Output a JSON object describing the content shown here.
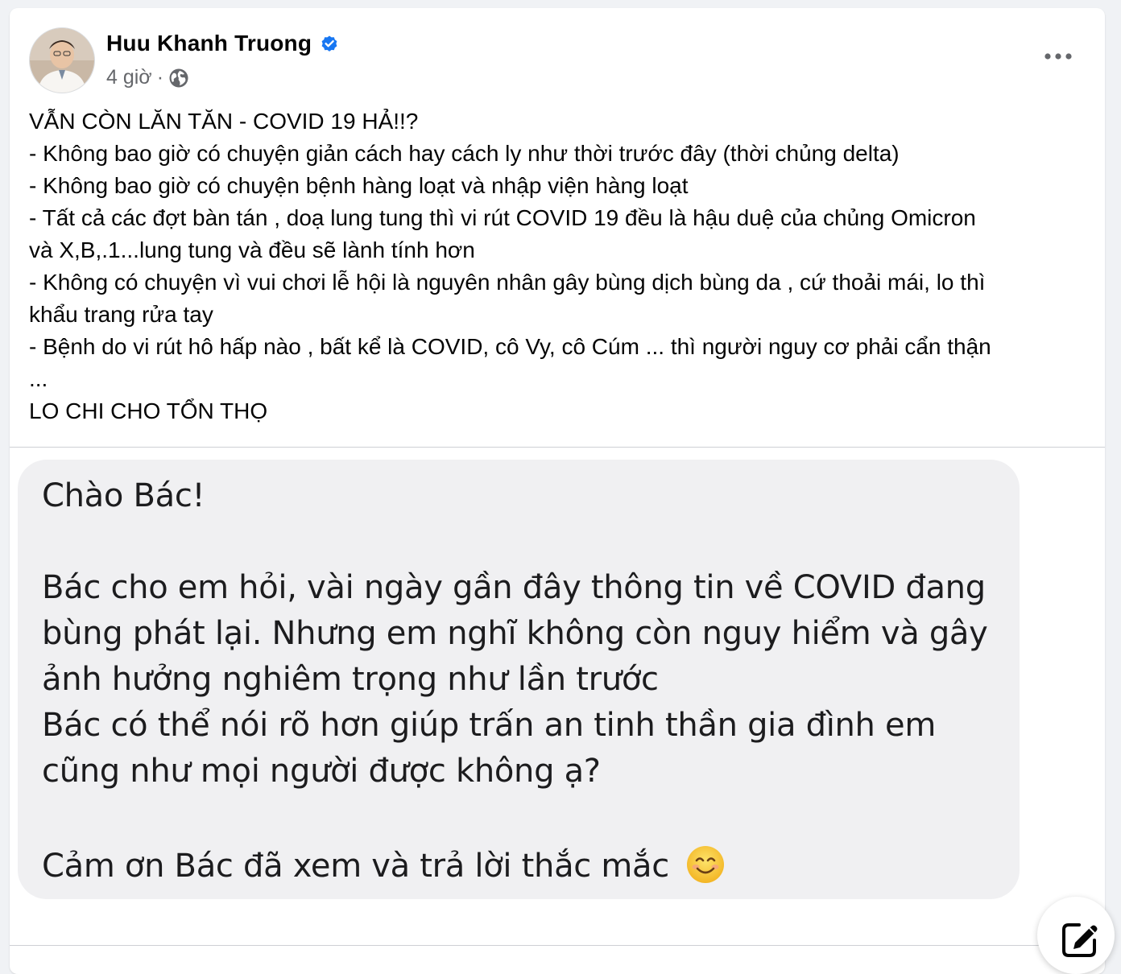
{
  "post": {
    "author": "Huu Khanh Truong",
    "time": "4 giờ",
    "separator": "·",
    "verified": true,
    "privacy_icon": "globe-icon",
    "more_icon": "more-dots-icon",
    "text_lines": [
      "VẪN CÒN LĂN TĂN - COVID 19 HẢ!!?",
      "- Không bao giờ có chuyện giản cách hay cách ly như thời trước đây (thời chủng delta)",
      "- Không bao giờ có chuyện bệnh hàng loạt và nhập viện hàng loạt",
      "- Tất cả các đợt bàn tán , doạ lung tung thì vi rút COVID 19 đều là hậu duệ của chủng Omicron",
      "và X,B,.1...lung tung và đều sẽ lành tính hơn",
      "- Không có chuyện vì vui chơi lễ hội là nguyên nhân gây bùng dịch bùng da , cứ thoải mái, lo thì",
      "khẩu trang rửa tay",
      "- Bệnh do vi rút hô hấp nào , bất kể là COVID, cô Vy, cô Cúm ... thì người nguy cơ phải cẩn thận",
      "...",
      "LO CHI CHO TỔN THỌ"
    ]
  },
  "message": {
    "greeting": "Chào Bác!",
    "lines": [
      "  Bác cho em hỏi, vài ngày gần đây thông tin về COVID đang",
      "bùng phát lại. Nhưng em nghĩ không còn nguy hiểm và gây",
      "ảnh hưởng nghiêm trọng như lần trước",
      "    Bác có thể nói rõ hơn giúp trấn an tinh thần gia đình em",
      "cũng như mọi người được không ạ?"
    ],
    "closing": "Cảm ơn Bác đã xem và trả lời thắc mắc",
    "emoji": "smiling-face-emoji"
  },
  "compose_icon": "compose-icon",
  "colors": {
    "verified_blue": "#1877f2",
    "secondary_text": "#65676b",
    "bubble_bg": "#f0f0f2",
    "emoji_yellow": "#f7c531"
  }
}
